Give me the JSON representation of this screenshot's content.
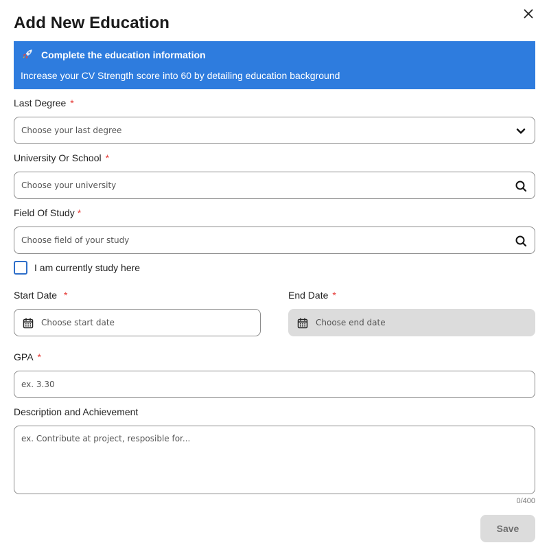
{
  "dialog": {
    "title": "Add New Education"
  },
  "banner": {
    "title": "Complete the education information",
    "text": "Increase your CV Strength score into 60 by detailing education background",
    "color": "#2e7cde",
    "icon": "rocket-icon"
  },
  "last_degree": {
    "label": "Last Degree",
    "required": "*",
    "placeholder": "Choose your last degree",
    "icon": "chevron-down-icon"
  },
  "university": {
    "label": "University Or School",
    "required": "*",
    "placeholder": "Choose your university",
    "icon": "search-icon"
  },
  "field_of_study": {
    "label": "Field Of Study",
    "required": "*",
    "placeholder": "Choose field of your study",
    "icon": "search-icon"
  },
  "currently_study": {
    "label": "I am currently study here",
    "checked": false
  },
  "start_date": {
    "label": "Start Date",
    "required": "*",
    "placeholder": "Choose start date",
    "icon": "calendar-icon"
  },
  "end_date": {
    "label": "End Date",
    "required": "*",
    "placeholder": "Choose end date",
    "icon": "calendar-icon",
    "disabled": true
  },
  "gpa": {
    "label": "GPA",
    "required": "*",
    "placeholder": "ex. 3.30"
  },
  "description": {
    "label": "Description and Achievement",
    "placeholder": "ex. Contribute at project, resposible for...",
    "counter": "0/400"
  },
  "actions": {
    "save_label": "Save"
  },
  "colors": {
    "required": "#e53935",
    "border": "#8a8a8a",
    "disabled_bg": "#dcdcdc",
    "checkbox": "#2e6ec9"
  }
}
